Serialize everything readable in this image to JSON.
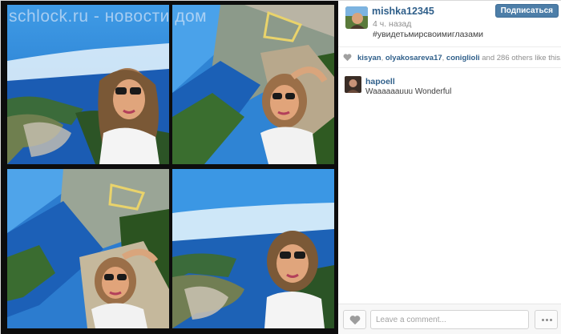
{
  "watermark": "schlock.ru - новости дом",
  "post": {
    "username": "mishka12345",
    "time_ago": "4 ч. назад",
    "caption": "#увидетьмирсвоимиглазами",
    "follow_label": "Подписаться"
  },
  "likes": {
    "users": [
      "kisyan",
      "olyakosareva17",
      "coniglioli"
    ],
    "sep1": ", ",
    "sep2": ", ",
    "and_text": " and ",
    "others_count": "286",
    "others_text": " others like this."
  },
  "comments": [
    {
      "user": "hapoell",
      "text": "Waaaaaauuu Wonderful"
    }
  ],
  "composer": {
    "placeholder": "Leave a comment..."
  },
  "icons": {
    "like": "heart-icon",
    "more": "ellipsis-icon"
  },
  "colors": {
    "link": "#2f5f8a",
    "follow_button": "#4d7ea8",
    "sky": "#2f7fd0",
    "ocean": "#1a5fb8"
  }
}
